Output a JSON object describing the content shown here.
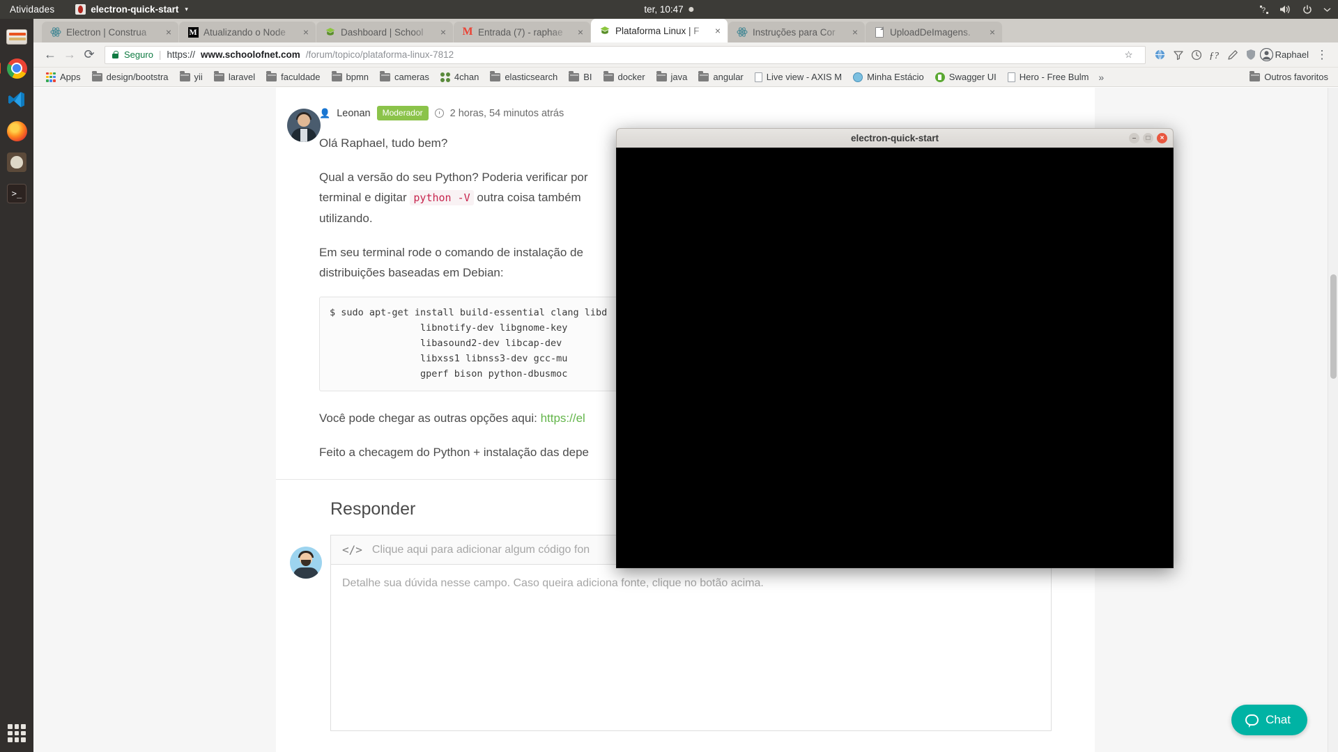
{
  "topbar": {
    "activities": "Atividades",
    "app_name": "electron-quick-start",
    "app_caret": "▾",
    "clock": "ter, 10:47",
    "icons": [
      "keyboard-indicator-icon",
      "volume-icon",
      "power-icon",
      "chevron-down-icon"
    ]
  },
  "dock": {
    "items": [
      {
        "name": "files",
        "label": "Arquivos"
      },
      {
        "name": "chrome",
        "label": "Google Chrome"
      },
      {
        "name": "vscode",
        "label": "Visual Studio Code"
      },
      {
        "name": "firefox",
        "label": "Firefox"
      },
      {
        "name": "gimp",
        "label": "GIMP"
      },
      {
        "name": "terminal",
        "label": "Terminal"
      }
    ],
    "show_apps_label": "Mostrar Aplicativos"
  },
  "browser": {
    "tabs": [
      {
        "title": "Electron | Construa",
        "favicon": "electron-icon",
        "active": false
      },
      {
        "title": "Atualizando o Node",
        "favicon": "medium-icon",
        "active": false
      },
      {
        "title": "Dashboard | School",
        "favicon": "schoolofnet-icon",
        "active": false
      },
      {
        "title": "Entrada (7) - raphae",
        "favicon": "gmail-icon",
        "active": false
      },
      {
        "title": "Plataforma Linux | F",
        "favicon": "schoolofnet-icon",
        "active": true
      },
      {
        "title": "Instruções para Cor",
        "favicon": "electron-icon",
        "active": false
      },
      {
        "title": "UploadDeImagens.",
        "favicon": "document-icon",
        "active": false
      }
    ],
    "tab_close_label": "×",
    "nav": {
      "back": "←",
      "forward": "→",
      "reload": "⟳"
    },
    "omnibox": {
      "secure_label": "Seguro",
      "separator": "|",
      "url_scheme": "https://",
      "url_host": "www.schoolofnet.com",
      "url_path": "/forum/topico/plataforma-linux-7812",
      "star_icon": "☆",
      "extensions": [
        "extension-globe-icon",
        "extension-filter-icon",
        "extension-clock-icon",
        "extension-fx-icon",
        "extension-pencil-icon",
        "extension-shield-icon"
      ],
      "avatar_label": "Raphael",
      "menu_icon": "⋮"
    },
    "bookmarks": [
      {
        "label": "Apps",
        "icon": "apps-grid-icon"
      },
      {
        "label": "design/bootstra",
        "icon": "folder-icon"
      },
      {
        "label": "yii",
        "icon": "folder-icon"
      },
      {
        "label": "laravel",
        "icon": "folder-icon"
      },
      {
        "label": "faculdade",
        "icon": "folder-icon"
      },
      {
        "label": "bpmn",
        "icon": "folder-icon"
      },
      {
        "label": "cameras",
        "icon": "folder-icon"
      },
      {
        "label": "4chan",
        "icon": "4chan-icon"
      },
      {
        "label": "elasticsearch",
        "icon": "folder-icon"
      },
      {
        "label": "BI",
        "icon": "folder-icon"
      },
      {
        "label": "docker",
        "icon": "folder-icon"
      },
      {
        "label": "java",
        "icon": "folder-icon"
      },
      {
        "label": "angular",
        "icon": "folder-icon"
      },
      {
        "label": "Live view - AXIS M",
        "icon": "document-icon"
      },
      {
        "label": "Minha Estácio",
        "icon": "globe-icon"
      },
      {
        "label": "Swagger UI",
        "icon": "swagger-icon"
      },
      {
        "label": "Hero - Free Bulm",
        "icon": "document-icon"
      }
    ],
    "bookmarks_overflow": "»",
    "other_bookmarks": "Outros favoritos",
    "other_bookmarks_icon": "folder-icon"
  },
  "post": {
    "author": "Leonan",
    "badge": "Moderador",
    "timestamp": "2 horas, 54 minutos atrás",
    "greeting": "Olá Raphael, tudo bem?",
    "p1_before": "Qual a versão do seu Python? Poderia verificar por",
    "p1_mid": "terminal e digitar",
    "p1_code": "python -V",
    "p1_after": "outra coisa também",
    "p1_end": "utilizando.",
    "p2_line1": "Em seu terminal rode o comando de instalação de",
    "p2_line2": "distribuições baseadas em Debian:",
    "code_block": "$ sudo apt-get install build-essential clang libd\n                libnotify-dev libgnome-key\n                libasound2-dev libcap-dev\n                libxss1 libnss3-dev gcc-mu\n                gperf bison python-dbusmoc",
    "p3_text": "Você pode chegar as outras opções aqui:",
    "p3_link": "https://el",
    "p4": "Feito a checagem do Python + instalação das depe"
  },
  "responder": {
    "title": "Responder",
    "code_placeholder": "Clique aqui para adicionar algum código fon",
    "code_icon": "</>",
    "textarea_placeholder": "Detalhe sua dúvida nesse campo. Caso queira adiciona\nfonte, clique no botão acima."
  },
  "chat": {
    "label": "Chat",
    "icon": "chat-bubble-icon"
  },
  "electron": {
    "title": "electron-quick-start",
    "minimize": "–",
    "maximize": "□",
    "close": "×",
    "content": ""
  },
  "colors": {
    "ubuntu_bar": "#3c3b37",
    "ubuntu_accent": "#e95420",
    "chrome_tabstrip": "#cfccc7",
    "secure_green": "#0f7b42",
    "moderator_badge": "#8bc34a",
    "link_green": "#63b54a",
    "chat_teal": "#00b3a4",
    "code_pink": "#c7254e",
    "electron_close": "#e8573f"
  }
}
